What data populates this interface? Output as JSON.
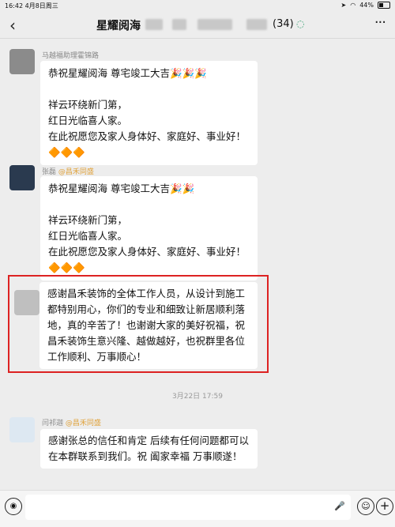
{
  "status": {
    "time": "16:42",
    "date": "4月8日周三",
    "battery": "44%",
    "battery_level": 0.44
  },
  "header": {
    "back_icon": "chevron-left-icon",
    "title": "星耀阅海",
    "member_count": "(34)",
    "more_icon": "more-icon"
  },
  "messages": [
    {
      "sender": "马越福助理霍锦路",
      "tag": "",
      "text": "恭祝星耀阅海 尊宅竣工大吉🎉🎉🎉\n\n祥云环绕新门第，\n红日光临喜人家。\n在此祝愿您及家人身体好、家庭好、事业好！🔶🔶🔶"
    },
    {
      "sender": "张磊",
      "tag": "@昌禾同盛",
      "text": "恭祝星耀阅海 尊宅竣工大吉🎉🎉\n\n祥云环绕新门第，\n红日光临喜人家。\n在此祝愿您及家人身体好、家庭好、事业好！🔶🔶🔶"
    },
    {
      "sender": "",
      "tag": "",
      "text": "感谢昌禾装饰的全体工作人员，从设计到施工都特别用心，你们的专业和细致让新居顺利落地，真的辛苦了！也谢谢大家的美好祝福，祝昌禾装饰生意兴隆、越做越好，也祝群里各位工作顺利、万事顺心！"
    },
    {
      "sender": "闫祁迦",
      "tag": "@昌禾同盛",
      "text": "感谢张总的信任和肯定 后续有任何问题都可以在本群联系到我们。祝 阖家幸福 万事顺遂！"
    }
  ],
  "timestamp": "3月22日 17:59",
  "input": {
    "placeholder": ""
  }
}
